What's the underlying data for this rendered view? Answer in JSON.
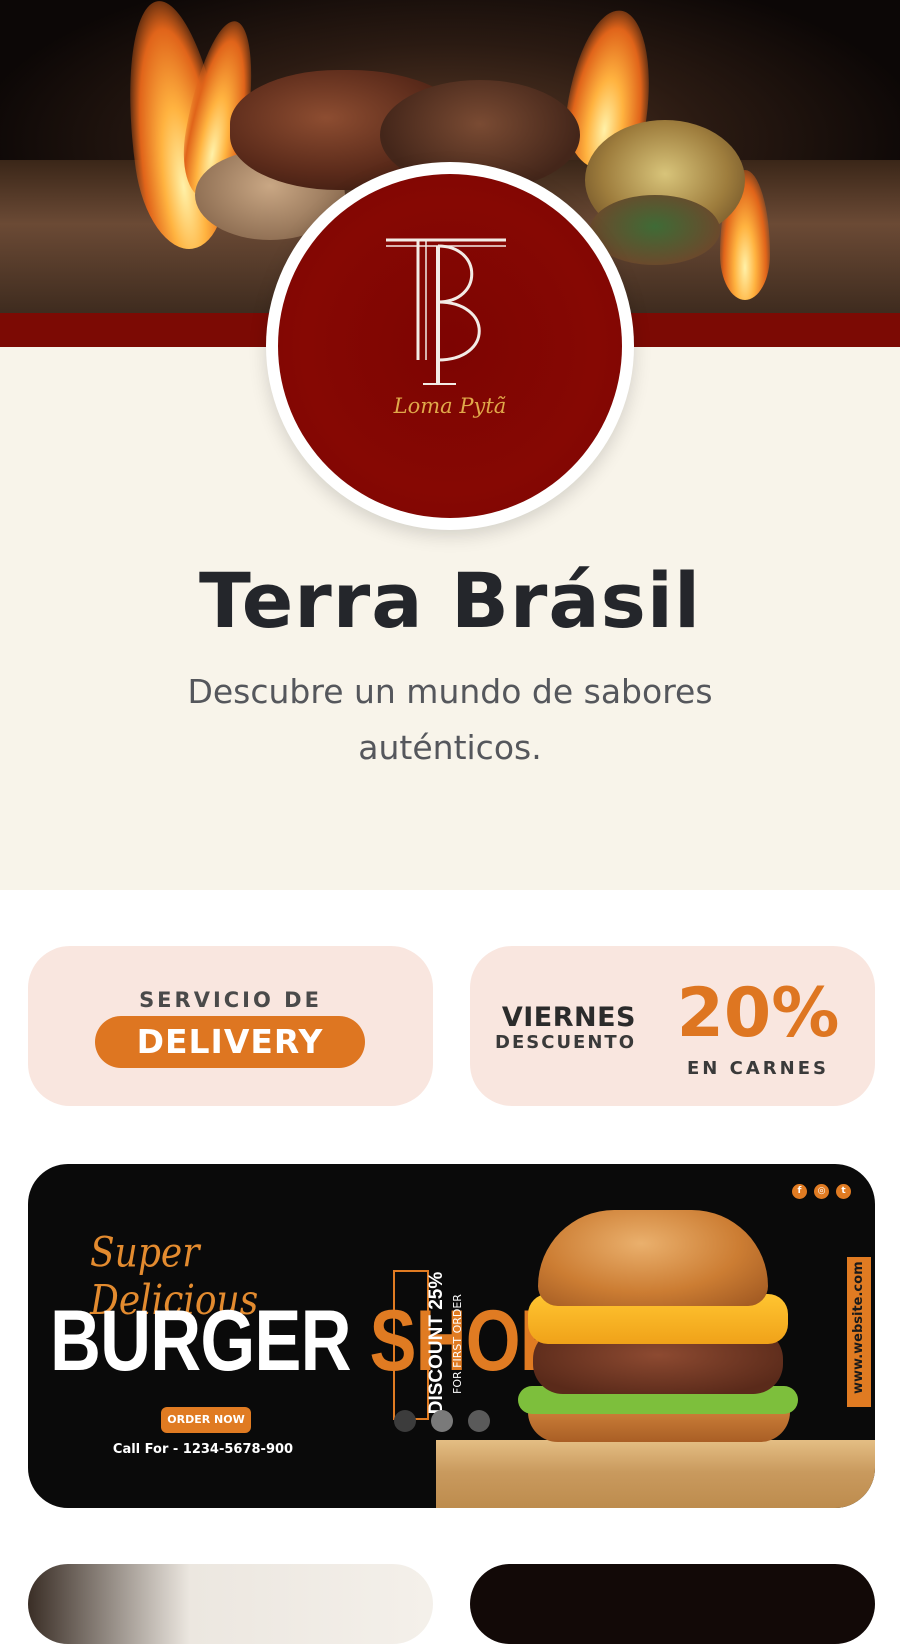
{
  "restaurant": {
    "name": "Terra Brásil",
    "tagline": "Descubre un mundo de sabores auténticos.",
    "logo_monogram": "TB",
    "logo_script": "Loma Pytã"
  },
  "promos": {
    "delivery": {
      "top": "SERVICIO DE",
      "pill": "DELIVERY"
    },
    "discount": {
      "day": "VIERNES",
      "label": "DESCUENTO",
      "percent": "20%",
      "sub": "EN CARNES"
    }
  },
  "banner": {
    "script": "Super Delicious",
    "headline_a": "BURGER",
    "headline_b": "SHOP",
    "discount": "DISCOUNT 25%",
    "discount_note": "FOR FIRST ORDER",
    "order_button": "ORDER NOW",
    "call": "Call For - 1234-5678-900",
    "website": "www.website.com",
    "social_icons": [
      "facebook-icon",
      "instagram-icon",
      "twitter-icon"
    ],
    "active_slide": 1,
    "slide_count": 3
  },
  "colors": {
    "brand_red": "#7c0a04",
    "accent_orange": "#de7621",
    "cream": "#f8f4ea",
    "promo_card": "#f9e6df",
    "title_text": "#24262b"
  }
}
